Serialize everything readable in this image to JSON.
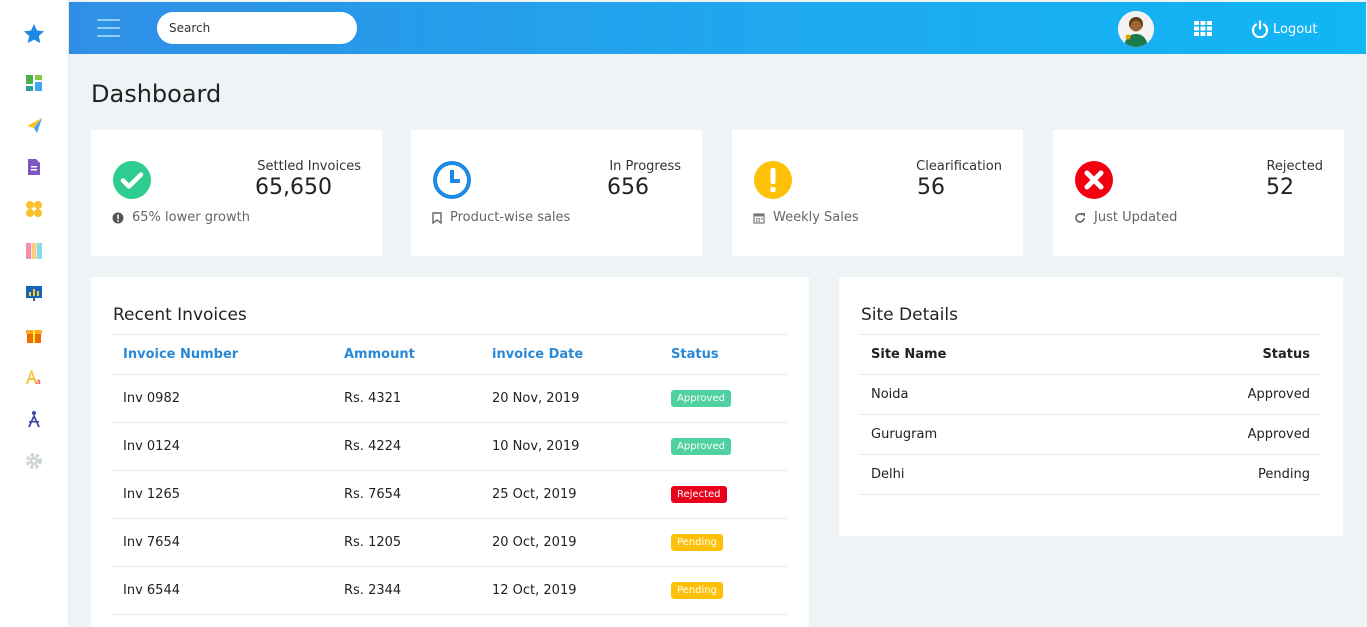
{
  "header": {
    "search_placeholder": "Search",
    "logout_label": "Logout"
  },
  "page": {
    "title": "Dashboard"
  },
  "stats": [
    {
      "label": "Settled Invoices",
      "value": "65,650",
      "footer": "65% lower growth",
      "icon": "check-circle-icon",
      "color": "#2ecc8f"
    },
    {
      "label": "In Progress",
      "value": "656",
      "footer": "Product-wise sales",
      "icon": "clock-icon",
      "color": "#1e88e5"
    },
    {
      "label": "Clearification",
      "value": "56",
      "footer": "Weekly Sales",
      "icon": "exclamation-circle-icon",
      "color": "#ffc107"
    },
    {
      "label": "Rejected",
      "value": "52",
      "footer": "Just Updated",
      "icon": "times-circle-icon",
      "color": "#f2000f"
    }
  ],
  "recent_invoices": {
    "title": "Recent Invoices",
    "columns": [
      "Invoice Number",
      "Ammount",
      "invoice Date",
      "Status"
    ],
    "rows": [
      {
        "number": "Inv 0982",
        "amount": "Rs. 4321",
        "date": "20 Nov, 2019",
        "status": "Approved"
      },
      {
        "number": "Inv 0124",
        "amount": "Rs. 4224",
        "date": "10 Nov, 2019",
        "status": "Approved"
      },
      {
        "number": "Inv 1265",
        "amount": "Rs. 7654",
        "date": "25 Oct, 2019",
        "status": "Rejected"
      },
      {
        "number": "Inv 7654",
        "amount": "Rs. 1205",
        "date": "20 Oct, 2019",
        "status": "Pending"
      },
      {
        "number": "Inv 6544",
        "amount": "Rs. 2344",
        "date": "12 Oct, 2019",
        "status": "Pending"
      }
    ],
    "status_colors": {
      "Approved": "#4fd1a1",
      "Rejected": "#e8001c",
      "Pending": "#ffc107"
    }
  },
  "site_details": {
    "title": "Site Details",
    "columns": [
      "Site Name",
      "Status"
    ],
    "rows": [
      {
        "name": "Noida",
        "status": "Approved"
      },
      {
        "name": "Gurugram",
        "status": "Approved"
      },
      {
        "name": "Delhi",
        "status": "Pending"
      }
    ]
  }
}
